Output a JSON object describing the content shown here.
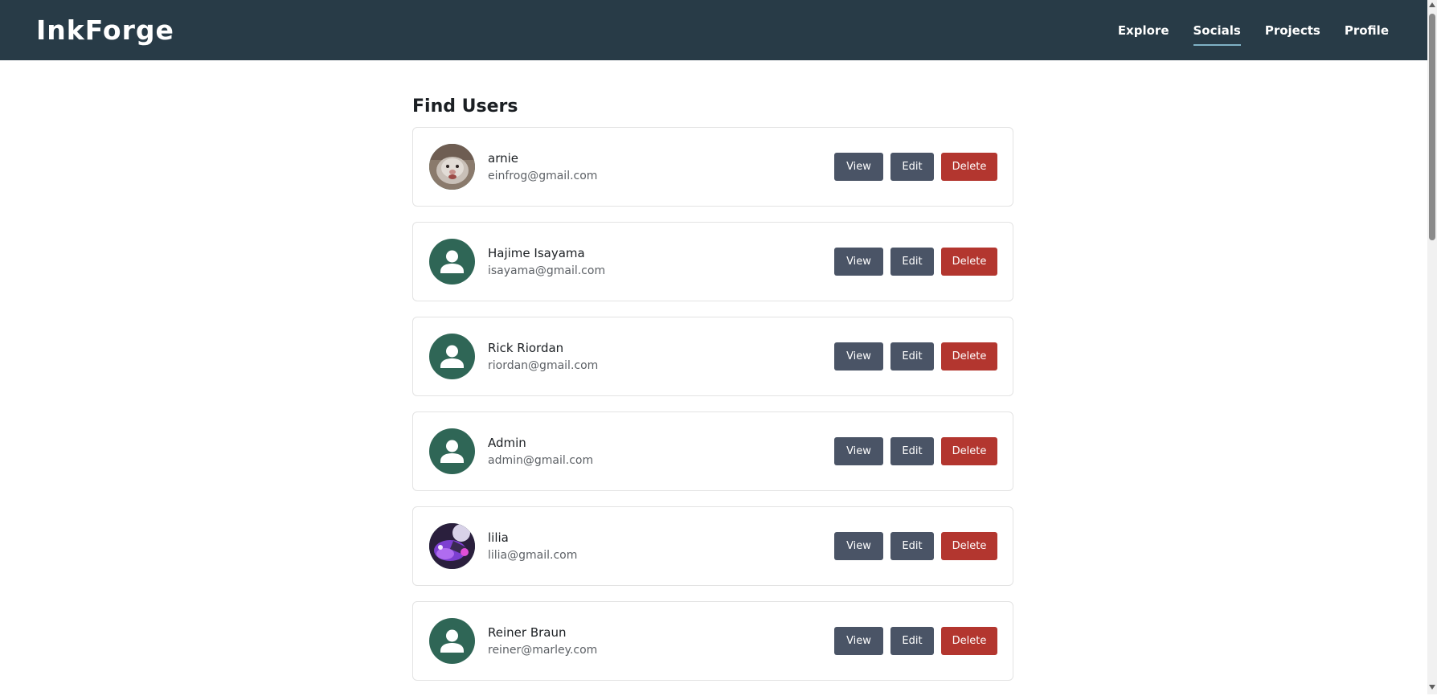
{
  "nav": {
    "logo": "InkForge",
    "links": [
      {
        "label": "Explore"
      },
      {
        "label": "Socials",
        "active": true
      },
      {
        "label": "Projects"
      },
      {
        "label": "Profile"
      }
    ]
  },
  "page": {
    "title": "Find Users"
  },
  "actions": {
    "view_label": "View",
    "edit_label": "Edit",
    "delete_label": "Delete"
  },
  "users": [
    {
      "name": "arnie",
      "email": "einfrog@gmail.com",
      "avatar": "photo-cat"
    },
    {
      "name": "Hajime Isayama",
      "email": "isayama@gmail.com",
      "avatar": "default-person-icon"
    },
    {
      "name": "Rick Riordan",
      "email": "riordan@gmail.com",
      "avatar": "default-person-icon"
    },
    {
      "name": "Admin",
      "email": "admin@gmail.com",
      "avatar": "default-person-icon"
    },
    {
      "name": "lilia",
      "email": "lilia@gmail.com",
      "avatar": "photo-purple"
    },
    {
      "name": "Reiner Braun",
      "email": "reiner@marley.com",
      "avatar": "default-person-icon"
    }
  ],
  "colors": {
    "navbar": "#283b47",
    "avatar_default": "#2f6656",
    "button_neutral": "#4a5466",
    "button_danger": "#b3362f",
    "active_underline": "#7fb2c5"
  }
}
